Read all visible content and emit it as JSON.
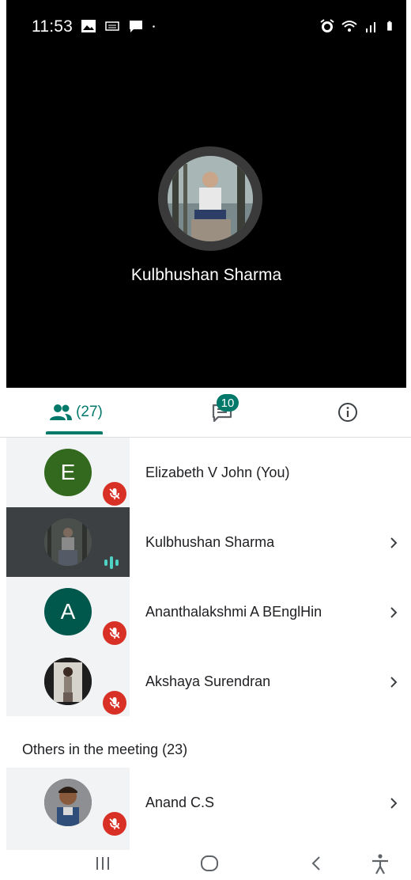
{
  "status_bar": {
    "time": "11:53",
    "left_icons": [
      "image-icon",
      "sim-icon",
      "message-icon",
      "dot-icon"
    ],
    "right_icons": [
      "alarm-icon",
      "wifi-icon",
      "signal-icon",
      "battery-icon"
    ]
  },
  "speaker": {
    "name": "Kulbhushan Sharma"
  },
  "tabs": {
    "people_count": "(27)",
    "chat_badge": "10"
  },
  "participants": [
    {
      "name": "Elizabeth V John (You)",
      "initial": "E",
      "avatar_color": "#33691e",
      "muted": true,
      "active": false,
      "has_chevron": false
    },
    {
      "name": "Kulbhushan Sharma",
      "initial": "",
      "avatar_color": "#555555",
      "muted": false,
      "active": true,
      "has_chevron": true
    },
    {
      "name": "Ananthalakshmi A BEnglHin",
      "initial": "A",
      "avatar_color": "#00574b",
      "muted": true,
      "active": false,
      "has_chevron": true
    },
    {
      "name": "Akshaya Surendran",
      "initial": "",
      "avatar_color": "#2d2d2d",
      "muted": true,
      "active": false,
      "has_chevron": true
    }
  ],
  "others": {
    "header": "Others in the meeting (23)",
    "items": [
      {
        "name": "Anand C.S",
        "initial": "",
        "avatar_color": "#6d4c41",
        "muted": true,
        "has_chevron": true
      }
    ]
  },
  "colors": {
    "accent": "#00796b",
    "mute_red": "#d93025",
    "speaking": "#4fd1c5"
  }
}
